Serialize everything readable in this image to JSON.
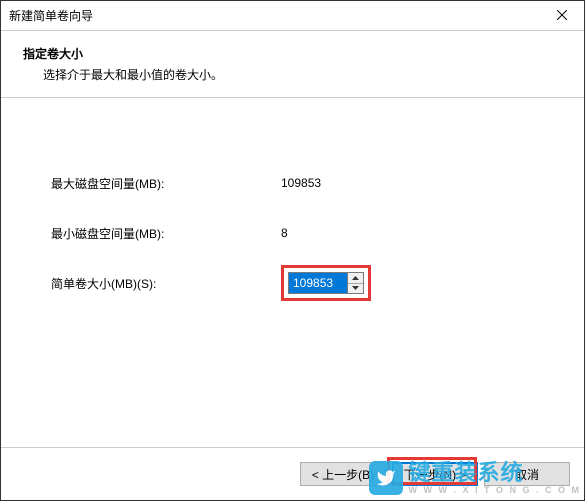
{
  "window": {
    "title": "新建简单卷向导"
  },
  "header": {
    "heading": "指定卷大小",
    "subheading": "选择介于最大和最小值的卷大小。"
  },
  "fields": {
    "max_label": "最大磁盘空间量(MB):",
    "max_value": "109853",
    "min_label": "最小磁盘空间量(MB):",
    "min_value": "8",
    "size_label": "简单卷大小(MB)(S):",
    "size_value": "109853"
  },
  "footer": {
    "back": "< 上一步(B)",
    "next": "下一步(N) >",
    "cancel": "取消"
  },
  "watermark": {
    "main": "键重装系统",
    "sub": "W  W  W  .  X  I  T  O  N  G  .  C  O  M"
  }
}
